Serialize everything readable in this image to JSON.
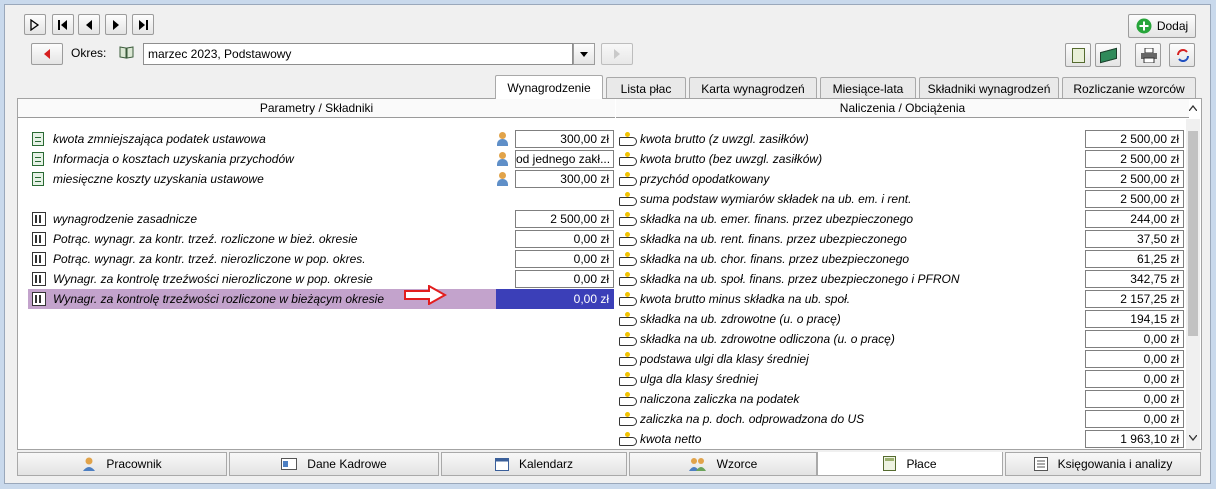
{
  "toolbar": {
    "add_label": "Dodaj",
    "period_label": "Okres:",
    "period_value": "marzec 2023, Podstawowy"
  },
  "tabs": [
    {
      "label": "Wynagrodzenie",
      "active": true
    },
    {
      "label": "Lista płac",
      "active": false
    },
    {
      "label": "Karta wynagrodzeń",
      "active": false
    },
    {
      "label": "Miesiące-lata",
      "active": false
    },
    {
      "label": "Składniki wynagrodzeń",
      "active": false
    },
    {
      "label": "Rozliczanie wzorców",
      "active": false
    }
  ],
  "left_panel": {
    "header": "Parametry / Składniki",
    "rows": [
      {
        "name": "kwota zmniejszająca podatek ustawowa",
        "value": "300,00 zł",
        "icon": "document-list-icon",
        "has_people": true
      },
      {
        "name": "Informacja o kosztach uzyskania przychodów",
        "value": "od jednego zakł...",
        "icon": "document-list-icon",
        "has_people": true
      },
      {
        "name": "miesięczne koszty uzyskania ustawowe",
        "value": "300,00 zł",
        "icon": "document-list-icon",
        "has_people": true
      },
      {
        "name": "wynagrodzenie zasadnicze",
        "value": "2 500,00 zł",
        "icon": "calculator-icon",
        "has_people": false
      },
      {
        "name": "Potrąc. wynagr. za kontr. trzeź. rozliczone w bież. okresie",
        "value": "0,00 zł",
        "icon": "calculator-icon",
        "has_people": false
      },
      {
        "name": "Potrąc. wynagr. za kontr. trzeź. nierozliczone w pop. okres.",
        "value": "0,00 zł",
        "icon": "calculator-icon",
        "has_people": false
      },
      {
        "name": "Wynagr. za kontrolę trzeźwości nierozliczone w pop. okresie",
        "value": "0,00 zł",
        "icon": "calculator-icon",
        "has_people": false
      },
      {
        "name": "Wynagr. za kontrolę trzeźwości rozliczone w bieżącym okresie",
        "value": "0,00 zł",
        "icon": "calculator-icon",
        "has_people": false,
        "selected": true
      }
    ]
  },
  "right_panel": {
    "header": "Naliczenia / Obciążenia",
    "rows": [
      {
        "name": "kwota brutto (z uwzgl. zasiłków)",
        "value": "2 500,00 zł"
      },
      {
        "name": "kwota brutto (bez uwzgl. zasiłków)",
        "value": "2 500,00 zł"
      },
      {
        "name": "przychód opodatkowany",
        "value": "2 500,00 zł"
      },
      {
        "name": "suma podstaw wymiarów składek na ub. em. i rent.",
        "value": "2 500,00 zł"
      },
      {
        "name": "składka na ub. emer. finans. przez ubezpieczonego",
        "value": "244,00 zł"
      },
      {
        "name": "składka na ub. rent. finans. przez ubezpieczonego",
        "value": "37,50 zł"
      },
      {
        "name": "składka na ub. chor. finans. przez ubezpieczonego",
        "value": "61,25 zł"
      },
      {
        "name": "składka na ub. społ. finans. przez ubezpieczonego i PFRON",
        "value": "342,75 zł"
      },
      {
        "name": "kwota brutto minus składka na ub. społ.",
        "value": "2 157,25 zł"
      },
      {
        "name": "składka na ub. zdrowotne (u. o pracę)",
        "value": "194,15 zł"
      },
      {
        "name": "składka na ub. zdrowotne odliczona (u. o pracę)",
        "value": "0,00 zł"
      },
      {
        "name": "podstawa ulgi dla klasy średniej",
        "value": "0,00 zł"
      },
      {
        "name": "ulga dla klasy średniej",
        "value": "0,00 zł"
      },
      {
        "name": "naliczona zaliczka na podatek",
        "value": "0,00 zł"
      },
      {
        "name": "zaliczka na p. doch. odprowadzona do US",
        "value": "0,00 zł"
      },
      {
        "name": "kwota netto",
        "value": "1 963,10 zł"
      }
    ]
  },
  "bottom_tabs": [
    {
      "label": "Pracownik",
      "icon": "person-icon",
      "active": false
    },
    {
      "label": "Dane Kadrowe",
      "icon": "id-card-icon",
      "active": false
    },
    {
      "label": "Kalendarz",
      "icon": "calendar-icon",
      "active": false
    },
    {
      "label": "Wzorce",
      "icon": "users-icon",
      "active": false
    },
    {
      "label": "Płace",
      "icon": "calculator-icon",
      "active": true
    },
    {
      "label": "Księgowania i analizy",
      "icon": "ledger-icon",
      "active": false
    }
  ],
  "colors": {
    "selected_row": "#c3a3cc",
    "selected_value": "#3b3fb8",
    "arrow": "#e21e1e",
    "add_icon": "#27a53a"
  }
}
